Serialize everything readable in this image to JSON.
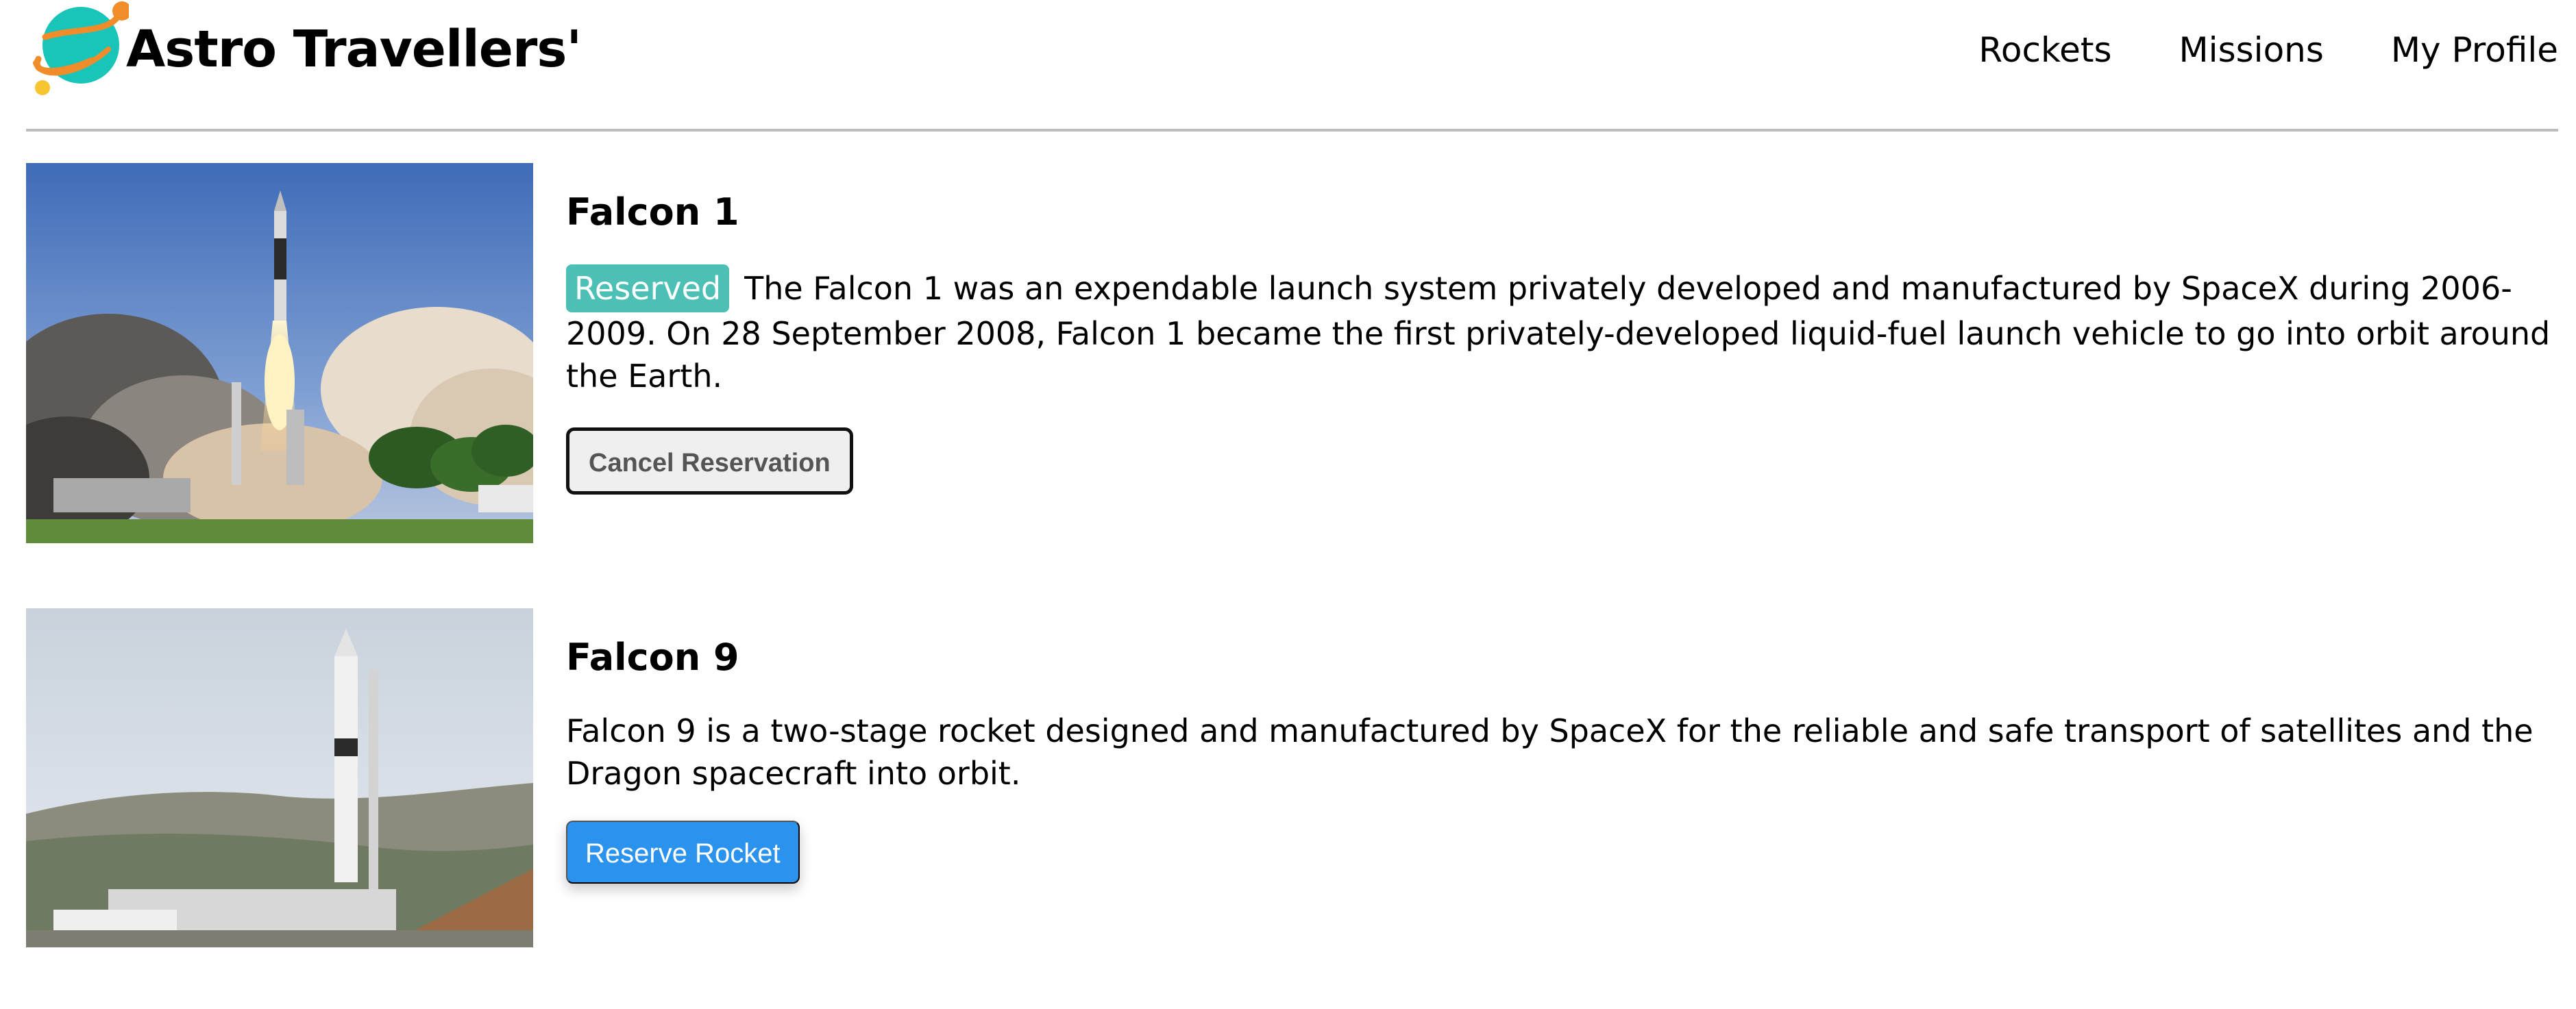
{
  "brand": {
    "title": "Astro Travellers'",
    "logo_icon": "planet-icon"
  },
  "nav": {
    "items": [
      {
        "label": "Rockets"
      },
      {
        "label": "Missions"
      },
      {
        "label": "My Profile"
      }
    ]
  },
  "rockets": [
    {
      "name": "Falcon 1",
      "reserved": true,
      "badge": "Reserved",
      "description": "The Falcon 1 was an expendable launch system privately developed and manufactured by SpaceX during 2006-2009. On 28 September 2008, Falcon 1 became the first privately-developed liquid-fuel launch vehicle to go into orbit around the Earth.",
      "button_label": "Cancel Reservation",
      "image_icon": "rocket-launch-photo"
    },
    {
      "name": "Falcon 9",
      "reserved": false,
      "description": "Falcon 9 is a two-stage rocket designed and manufactured by SpaceX for the reliable and safe transport of satellites and the Dragon spacecraft into orbit.",
      "button_label": "Reserve Rocket",
      "image_icon": "rocket-pad-photo"
    }
  ],
  "colors": {
    "badge": "#4cc0b5",
    "reserve_button": "#2b93ee",
    "divider": "#bdbdbd"
  }
}
